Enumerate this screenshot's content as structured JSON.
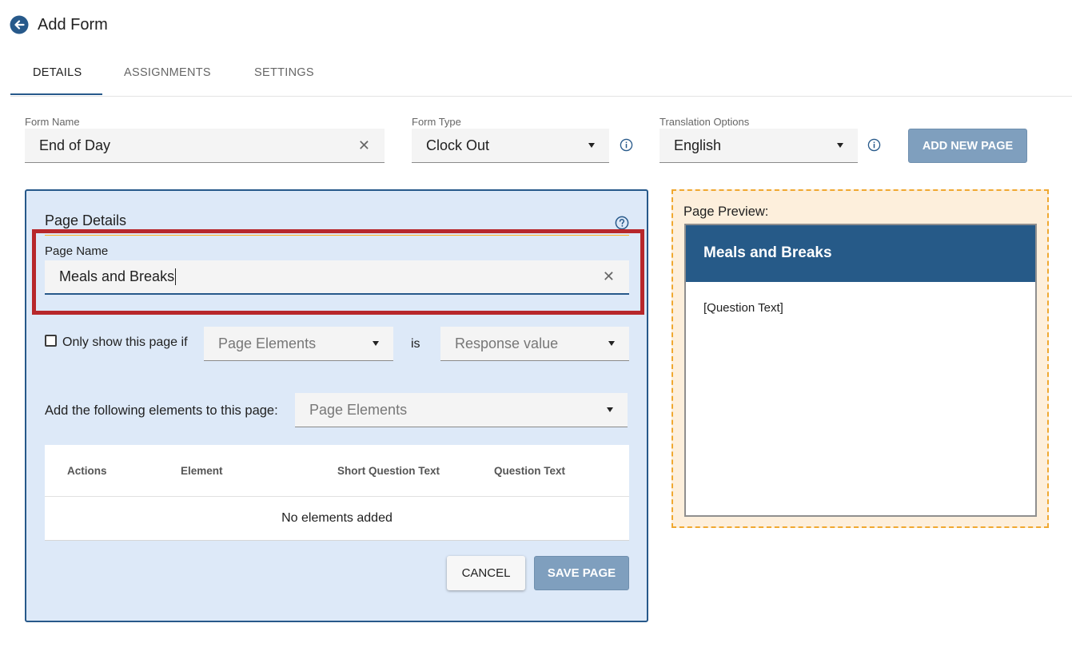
{
  "header": {
    "title": "Add Form"
  },
  "tabs": [
    {
      "label": "DETAILS",
      "active": true
    },
    {
      "label": "ASSIGNMENTS",
      "active": false
    },
    {
      "label": "SETTINGS",
      "active": false
    }
  ],
  "form": {
    "name_label": "Form Name",
    "name_value": "End of Day",
    "type_label": "Form Type",
    "type_value": "Clock Out",
    "translation_label": "Translation Options",
    "translation_value": "English",
    "add_page_label": "ADD NEW PAGE"
  },
  "page_details": {
    "title": "Page Details",
    "page_name_label": "Page Name",
    "page_name_value": "Meals and Breaks",
    "only_show_label": "Only show this page if",
    "only_show_checked": false,
    "condition_element_placeholder": "Page Elements",
    "is_label": "is",
    "condition_value_placeholder": "Response value",
    "add_elements_label": "Add the following elements to this page:",
    "add_elements_placeholder": "Page Elements",
    "table": {
      "columns": [
        "Actions",
        "Element",
        "Short Question Text",
        "Question Text"
      ],
      "empty_message": "No elements added"
    },
    "cancel_label": "CANCEL",
    "save_label": "SAVE PAGE"
  },
  "preview": {
    "label": "Page Preview:",
    "page_title": "Meals and Breaks",
    "question_placeholder": "[Question Text]"
  },
  "colors": {
    "primary": "#27598a",
    "disabled_button": "#7f9fbe",
    "highlight": "#b7272b",
    "panel_bg": "#dde9f8",
    "preview_bg": "#fdefdc",
    "preview_border": "#f0a830"
  },
  "icons": {
    "back": "arrow-left-circle-icon",
    "clear": "close-icon",
    "dropdown": "caret-down-icon",
    "info": "info-circle-icon",
    "help": "question-circle-icon"
  }
}
